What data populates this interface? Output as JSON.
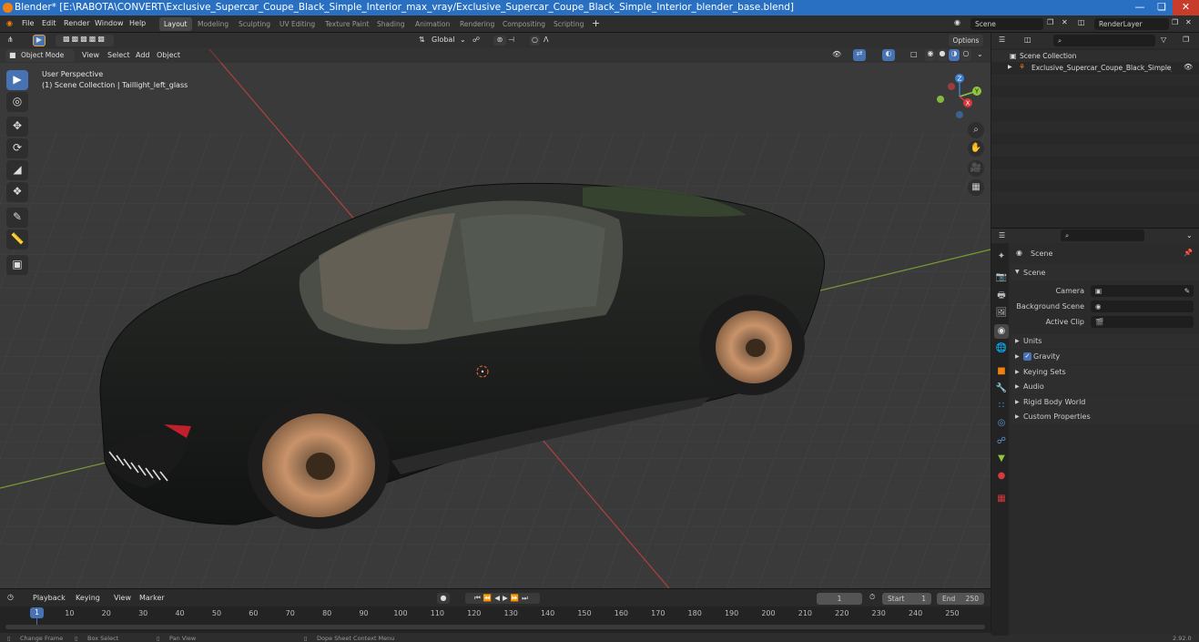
{
  "titlebar": {
    "title": "Blender* [E:\\RABOTA\\CONVERT\\Exclusive_Supercar_Coupe_Black_Simple_Interior_max_vray/Exclusive_Supercar_Coupe_Black_Simple_Interior_blender_base.blend]"
  },
  "menu": {
    "file": "File",
    "edit": "Edit",
    "render": "Render",
    "window": "Window",
    "help": "Help"
  },
  "workspaces": [
    "Layout",
    "Modeling",
    "Sculpting",
    "UV Editing",
    "Texture Paint",
    "Shading",
    "Animation",
    "Rendering",
    "Compositing",
    "Scripting"
  ],
  "scene_selector": {
    "value": "Scene"
  },
  "renderlayer_selector": {
    "value": "RenderLayer"
  },
  "viewport": {
    "transform_orientation": "Global",
    "options_label": "Options",
    "mode": "Object Mode",
    "menu_view": "View",
    "menu_select": "Select",
    "menu_add": "Add",
    "menu_object": "Object",
    "info_line1": "User Perspective",
    "info_line2": "(1) Scene Collection | Taillight_left_glass"
  },
  "gizmo": {
    "z": "Z",
    "y": "Y",
    "x": "X"
  },
  "outliner": {
    "root": "Scene Collection",
    "item": "Exclusive_Supercar_Coupe_Black_Simple_In"
  },
  "properties": {
    "context": "Scene",
    "panel_title": "Scene",
    "camera_label": "Camera",
    "background_scene_label": "Background Scene",
    "active_clip_label": "Active Clip",
    "sections": [
      "Units",
      "Gravity",
      "Keying Sets",
      "Audio",
      "Rigid Body World",
      "Custom Properties"
    ],
    "gravity_enabled": true
  },
  "timeline": {
    "playback": "Playback",
    "keying": "Keying",
    "view": "View",
    "marker": "Marker",
    "current_frame": "1",
    "start_label": "Start",
    "start_value": "1",
    "end_label": "End",
    "end_value": "250",
    "playhead": "1",
    "ticks": [
      "10",
      "20",
      "30",
      "40",
      "50",
      "60",
      "70",
      "80",
      "90",
      "100",
      "110",
      "120",
      "130",
      "140",
      "150",
      "160",
      "170",
      "180",
      "190",
      "200",
      "210",
      "220",
      "230",
      "240",
      "250"
    ]
  },
  "statusbar": {
    "change_frame": "Change Frame",
    "box_select": "Box Select",
    "pan_view": "Pan View",
    "context_menu": "Dope Sheet Context Menu",
    "version": "2.92.0"
  },
  "colors": {
    "accent": "#4772b3",
    "titlebar": "#2a70c2",
    "x_axis": "#d9383c",
    "y_axis": "#8ec63f",
    "z_axis": "#3c7fd5"
  }
}
